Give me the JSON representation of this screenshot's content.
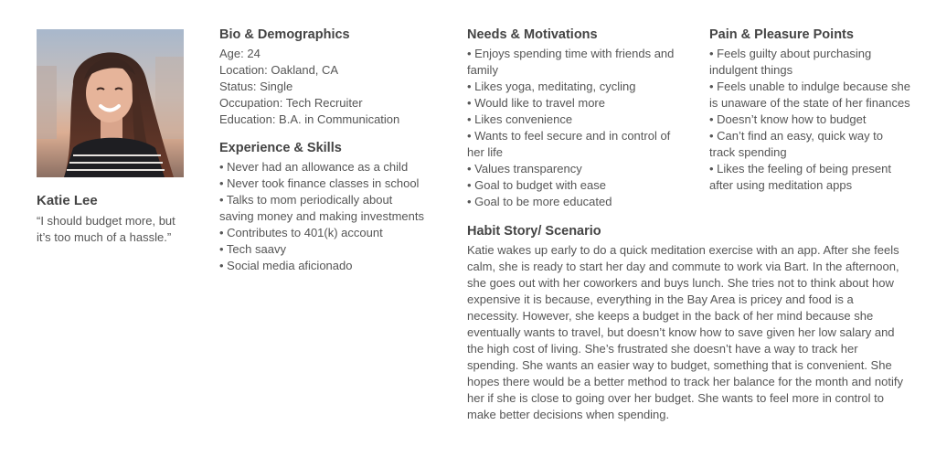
{
  "persona": {
    "name": "Katie Lee",
    "quote": "“I should budget more, but it’s too much of a hassle.”"
  },
  "bio": {
    "heading": "Bio & Demographics",
    "lines": [
      "Age: 24",
      "Location: Oakland, CA",
      "Status: Single",
      "Occupation: Tech Recruiter",
      "Education: B.A. in Communication"
    ]
  },
  "experience": {
    "heading": "Experience & Skills",
    "items": [
      "• Never had an allowance as a child",
      "• Never took finance classes in school",
      "• Talks to mom periodically about saving money and making investments",
      "• Contributes to 401(k) account",
      "• Tech saavy",
      "• Social media aficionado"
    ]
  },
  "needs": {
    "heading": "Needs & Motivations",
    "items": [
      "• Enjoys spending time with friends and family",
      "• Likes yoga, meditating, cycling",
      "• Would like to travel more",
      "• Likes convenience",
      "• Wants to feel secure and in control of her life",
      "• Values transparency",
      "• Goal to budget with ease",
      "• Goal to be more educated"
    ]
  },
  "pain": {
    "heading": "Pain & Pleasure Points",
    "items": [
      "• Feels guilty about purchasing indulgent things",
      "• Feels unable to indulge because she is unaware of the state of her finances",
      "• Doesn’t know how to budget",
      "• Can’t find an easy, quick way to track spending",
      "• Likes the feeling of being present after using meditation apps"
    ]
  },
  "story": {
    "heading": "Habit Story/ Scenario",
    "text": "Katie wakes up early to do a quick meditation exercise with an app. After she feels calm, she is ready to start her day and commute to work via Bart. In the afternoon, she goes out with her coworkers and buys lunch. She tries not to think about how expensive it is because, everything in the Bay Area is pricey and food is a necessity. However, she keeps a budget in the back of her mind because she eventually wants to travel, but doesn’t know how to save given her low salary and the high cost of living. She’s frustrated she doesn’t have a way to track her spending. She wants an easier way to budget, something that is convenient. She hopes there would be a better method to track her balance for the month and notify her if she is close to going over her budget. She wants to feel more in control to make better decisions when spending."
  }
}
